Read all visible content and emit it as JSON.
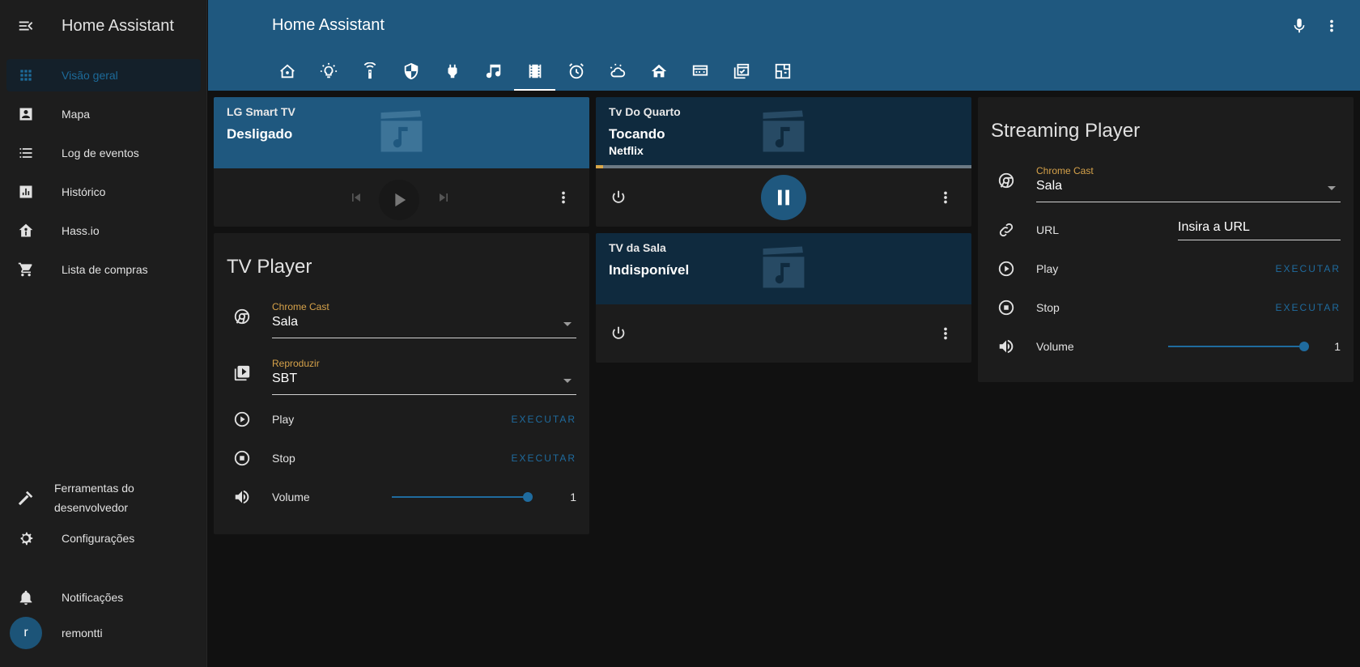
{
  "sidebar": {
    "title": "Home Assistant",
    "items": [
      {
        "label": "Visão geral",
        "icon": "grid-icon",
        "active": true
      },
      {
        "label": "Mapa",
        "icon": "map-account-icon"
      },
      {
        "label": "Log de eventos",
        "icon": "list-icon"
      },
      {
        "label": "Histórico",
        "icon": "chart-icon"
      },
      {
        "label": "Hass.io",
        "icon": "home-assistant-icon"
      },
      {
        "label": "Lista de compras",
        "icon": "cart-icon"
      }
    ],
    "dev_tools": {
      "line1": "Ferramentas do",
      "line2": "desenvolvedor"
    },
    "settings": "Configurações",
    "notifications": "Notificações",
    "user": {
      "initial": "r",
      "name": "remontti"
    }
  },
  "header": {
    "title": "Home Assistant",
    "tabs": [
      "home-icon",
      "bulb-icon",
      "remote-icon",
      "shield-icon",
      "plug-icon",
      "music-icon",
      "film-icon",
      "alarm-icon",
      "weather-icon",
      "house-icon",
      "projector-icon",
      "calendar-icon",
      "floorplan-icon"
    ],
    "active_tab": 6
  },
  "media_players": {
    "lg": {
      "name": "LG Smart TV",
      "state": "Desligado"
    },
    "quarto": {
      "name": "Tv Do Quarto",
      "state": "Tocando",
      "app": "Netflix",
      "progress": 0.02
    },
    "sala": {
      "name": "TV da Sala",
      "state": "Indisponível"
    }
  },
  "tv_player": {
    "title": "TV Player",
    "chrome_cast": {
      "label": "Chrome Cast",
      "value": "Sala"
    },
    "reproduzir": {
      "label": "Reproduzir",
      "value": "SBT"
    },
    "play": {
      "name": "Play",
      "action": "EXECUTAR"
    },
    "stop": {
      "name": "Stop",
      "action": "EXECUTAR"
    },
    "volume": {
      "name": "Volume",
      "value": "1",
      "level": 1
    }
  },
  "streaming_player": {
    "title": "Streaming Player",
    "chrome_cast": {
      "label": "Chrome Cast",
      "value": "Sala"
    },
    "url": {
      "name": "URL",
      "placeholder": "Insira a URL"
    },
    "play": {
      "name": "Play",
      "action": "EXECUTAR"
    },
    "stop": {
      "name": "Stop",
      "action": "EXECUTAR"
    },
    "volume": {
      "name": "Volume",
      "value": "1",
      "level": 1
    }
  },
  "colors": {
    "primary": "#1f587f",
    "accent": "#d6a24a",
    "background": "#111111"
  }
}
